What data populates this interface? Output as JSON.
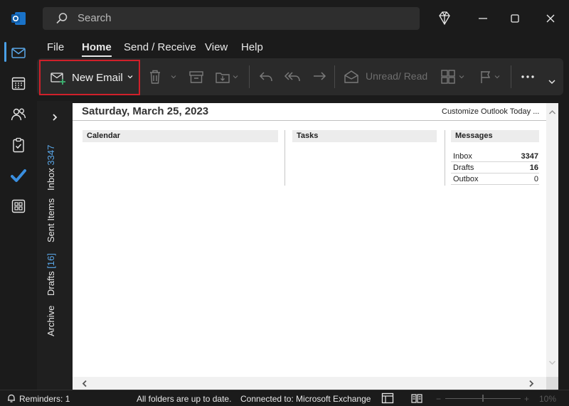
{
  "titlebar": {
    "search_placeholder": "Search"
  },
  "menu": {
    "tabs": [
      "File",
      "Home",
      "Send / Receive",
      "View",
      "Help"
    ],
    "active": "Home"
  },
  "ribbon": {
    "new_email_label": "New Email",
    "unread_read_label": "Unread/ Read"
  },
  "folders": {
    "inbox": {
      "label": "Inbox",
      "count": "3347"
    },
    "sent": {
      "label": "Sent Items"
    },
    "drafts": {
      "label": "Drafts",
      "count": "[16]"
    },
    "archive": {
      "label": "Archive"
    }
  },
  "today": {
    "date": "Saturday, March 25, 2023",
    "customize_link": "Customize Outlook Today ...",
    "calendar_header": "Calendar",
    "tasks_header": "Tasks",
    "messages_header": "Messages",
    "messages": [
      {
        "label": "Inbox",
        "value": "3347",
        "bold": true
      },
      {
        "label": "Drafts",
        "value": "16",
        "bold": true
      },
      {
        "label": "Outbox",
        "value": "0",
        "bold": false
      }
    ]
  },
  "status": {
    "reminders": "Reminders: 1",
    "sync": "All folders are up to date.",
    "connection": "Connected to: Microsoft Exchange",
    "zoom": "10%"
  },
  "colors": {
    "accent": "#4aa0e6",
    "highlight_border": "#d0202a",
    "todo_check": "#3a8fe0"
  }
}
